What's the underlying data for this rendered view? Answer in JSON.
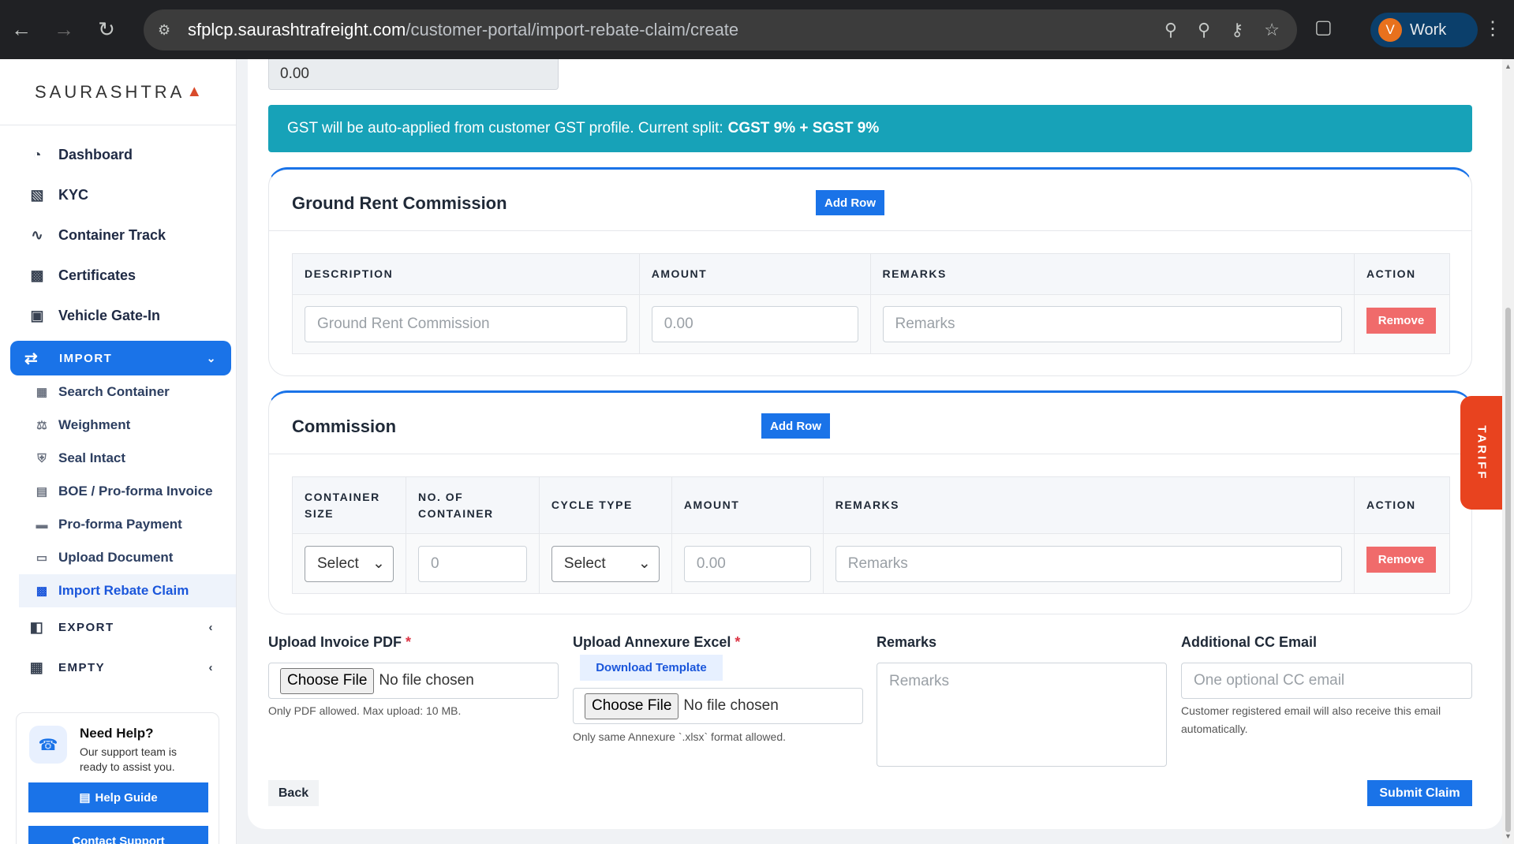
{
  "browser": {
    "url_host": "sfplcp.saurashtrafreight.com",
    "url_path": "/customer-portal/import-rebate-claim/create",
    "profile_initial": "V",
    "profile_label": "Work"
  },
  "sidebar": {
    "logo": "SAURASHTRA",
    "items": [
      {
        "label": "Dashboard",
        "icon": "dashboard-icon"
      },
      {
        "label": "KYC",
        "icon": "id-card-icon"
      },
      {
        "label": "Container Track",
        "icon": "route-icon"
      },
      {
        "label": "Certificates",
        "icon": "certificate-icon"
      },
      {
        "label": "Vehicle Gate-In",
        "icon": "truck-icon"
      }
    ],
    "import_label": "IMPORT",
    "import_items": [
      {
        "label": "Search Container",
        "icon": "container-search-icon"
      },
      {
        "label": "Weighment",
        "icon": "scale-icon"
      },
      {
        "label": "Seal Intact",
        "icon": "shield-icon"
      },
      {
        "label": "BOE / Pro-forma Invoice",
        "icon": "pdf-file-icon"
      },
      {
        "label": "Pro-forma Payment",
        "icon": "money-icon"
      },
      {
        "label": "Upload Document",
        "icon": "folder-open-icon"
      },
      {
        "label": "Import Rebate Claim",
        "icon": "invoice-dollar-icon"
      }
    ],
    "export_label": "EXPORT",
    "empty_label": "EMPTY",
    "help": {
      "title": "Need Help?",
      "text": "Our support team is ready to assist you.",
      "guide_label": "Help Guide",
      "contact_label": "Contact Support"
    }
  },
  "main": {
    "top_value": "0.00",
    "gst_alert_text": "GST will be auto-applied from customer GST profile. Current split:",
    "gst_alert_bold": "CGST 9% + SGST 9%",
    "ground_rent": {
      "title": "Ground Rent Commission",
      "add_row_label": "Add Row",
      "columns": [
        "DESCRIPTION",
        "AMOUNT",
        "REMARKS",
        "ACTION"
      ],
      "row": {
        "description_placeholder": "Ground Rent Commission",
        "amount_placeholder": "0.00",
        "remarks_placeholder": "Remarks",
        "remove_label": "Remove"
      }
    },
    "commission": {
      "title": "Commission",
      "add_row_label": "Add Row",
      "columns": [
        "CONTAINER SIZE",
        "NO. OF CONTAINER",
        "CYCLE TYPE",
        "AMOUNT",
        "REMARKS",
        "ACTION"
      ],
      "row": {
        "container_size": "Select",
        "no_of_container_placeholder": "0",
        "cycle_type": "Select",
        "amount_placeholder": "0.00",
        "remarks_placeholder": "Remarks",
        "remove_label": "Remove"
      }
    },
    "upload_invoice": {
      "label": "Upload Invoice PDF",
      "required": "*",
      "choose_label": "Choose File",
      "no_file": "No file chosen",
      "hint": "Only PDF allowed. Max upload: 10 MB."
    },
    "upload_annexure": {
      "label": "Upload Annexure Excel",
      "required": "*",
      "download_label": "Download Template",
      "choose_label": "Choose File",
      "no_file": "No file chosen",
      "hint": "Only same Annexure `.xlsx` format allowed."
    },
    "remarks": {
      "label": "Remarks",
      "placeholder": "Remarks"
    },
    "cc_email": {
      "label": "Additional CC Email",
      "placeholder": "One optional CC email",
      "hint": "Customer registered email will also receive this email automatically."
    },
    "back_label": "Back",
    "submit_label": "Submit Claim",
    "tariff_label": "TARIFF"
  },
  "colors": {
    "primary": "#1a73e8",
    "alert": "#17a2b8",
    "danger": "#f06b6b",
    "tariff": "#e8431f"
  }
}
